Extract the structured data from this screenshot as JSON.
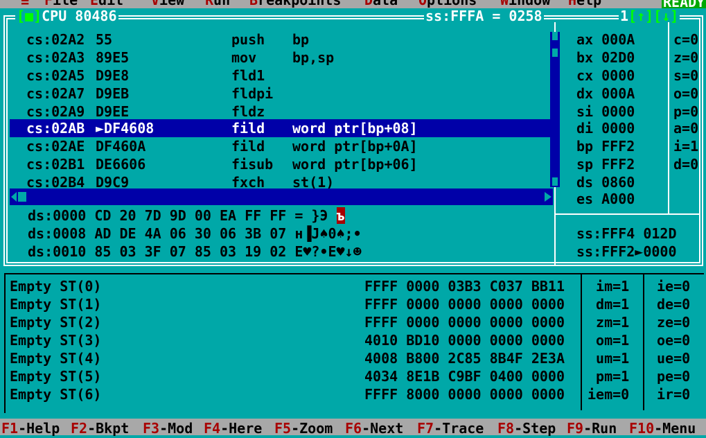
{
  "menu": {
    "system": "≡",
    "items": [
      {
        "hot": "F",
        "rest": "ile"
      },
      {
        "hot": "E",
        "rest": "dit"
      },
      {
        "hot": "V",
        "rest": "iew"
      },
      {
        "hot": "R",
        "rest": "un"
      },
      {
        "hot": "B",
        "rest": "reakpoints"
      },
      {
        "hot": "D",
        "rest": "ata"
      },
      {
        "hot": "O",
        "rest": "ptions"
      },
      {
        "hot": "W",
        "rest": "indow"
      },
      {
        "hot": "H",
        "rest": "elp"
      }
    ],
    "status": "READY"
  },
  "cpu": {
    "title": "CPU 80486",
    "close_box": "[■]",
    "stack_top": "ss:FFFA = 0258",
    "window_number": "1",
    "up_arrow": "[↑]",
    "down_arrow": "[↓]"
  },
  "disasm": [
    {
      "addr": "cs:02A2",
      "bytes": "55",
      "op": "push",
      "args": "bp"
    },
    {
      "addr": "cs:02A3",
      "bytes": "89E5",
      "op": "mov",
      "args": "bp,sp"
    },
    {
      "addr": "cs:02A5",
      "bytes": "D9E8",
      "op": "fld1",
      "args": ""
    },
    {
      "addr": "cs:02A7",
      "bytes": "D9EB",
      "op": "fldpi",
      "args": ""
    },
    {
      "addr": "cs:02A9",
      "bytes": "D9EE",
      "op": "fldz",
      "args": ""
    },
    {
      "addr": "cs:02AB",
      "bytes": "►DF4608",
      "op": "fild",
      "args": "word ptr[bp+08]"
    },
    {
      "addr": "cs:02AE",
      "bytes": "DF460A",
      "op": "fild",
      "args": "word ptr[bp+0A]"
    },
    {
      "addr": "cs:02B1",
      "bytes": "DE6606",
      "op": "fisub",
      "args": "word ptr[bp+06]"
    },
    {
      "addr": "cs:02B4",
      "bytes": "D9C9",
      "op": "fxch",
      "args": "st(1)"
    }
  ],
  "registers": [
    {
      "name": "ax",
      "value": "000A"
    },
    {
      "name": "bx",
      "value": "02D0"
    },
    {
      "name": "cx",
      "value": "0000"
    },
    {
      "name": "dx",
      "value": "000A"
    },
    {
      "name": "si",
      "value": "0000"
    },
    {
      "name": "di",
      "value": "0000"
    },
    {
      "name": "bp",
      "value": "FFF2"
    },
    {
      "name": "sp",
      "value": "FFF2"
    },
    {
      "name": "ds",
      "value": "0860"
    },
    {
      "name": "es",
      "value": "A000"
    }
  ],
  "flags": [
    "c=0",
    "z=0",
    "s=0",
    "o=0",
    "p=0",
    "a=0",
    "i=1",
    "d=0"
  ],
  "dump": [
    {
      "text": "ds:0000 CD 20 7D 9D 00 EA FF FF = }Э ",
      "tail": "ъ"
    },
    {
      "text": "ds:0008 AD DE 4A 06 30 06 3B 07 н▐J♠0♠;•",
      "tail": ""
    },
    {
      "text": "ds:0010 85 03 3F 07 85 03 19 02 Е♥?•Е♥↓☻",
      "tail": ""
    }
  ],
  "stack": [
    "ss:FFF4 012D",
    "ss:FFF2►0000"
  ],
  "fpu": {
    "registers": [
      {
        "label": "Empty ST(0)",
        "hex": "FFFF 0000 03B3 C037 BB11"
      },
      {
        "label": "Empty ST(1)",
        "hex": "FFFF 0000 0000 0000 0000"
      },
      {
        "label": "Empty ST(2)",
        "hex": "FFFF 0000 0000 0000 0000"
      },
      {
        "label": "Empty ST(3)",
        "hex": "4010 BD10 0000 0000 0000"
      },
      {
        "label": "Empty ST(4)",
        "hex": "4008 B800 2C85 8B4F 2E3A"
      },
      {
        "label": "Empty ST(5)",
        "hex": "4034 8E1B C9BF 0400 0000"
      },
      {
        "label": "Empty ST(6)",
        "hex": "FFFF 8000 0000 0000 0000"
      }
    ],
    "control": [
      " im=1",
      " dm=1",
      " zm=1",
      " om=1",
      " um=1",
      " pm=1",
      "iem=0"
    ],
    "status": [
      "ie=0",
      "de=0",
      "ze=0",
      "oe=0",
      "ue=0",
      "pe=0",
      "ir=0"
    ]
  },
  "function_keys": [
    {
      "key": "F1",
      "label": "-Help"
    },
    {
      "key": "F2",
      "label": "-Bkpt"
    },
    {
      "key": "F3",
      "label": "-Mod"
    },
    {
      "key": "F4",
      "label": "-Here"
    },
    {
      "key": "F5",
      "label": "-Zoom"
    },
    {
      "key": "F6",
      "label": "-Next"
    },
    {
      "key": "F7",
      "label": "-Trace"
    },
    {
      "key": "F8",
      "label": "-Step"
    },
    {
      "key": "F9",
      "label": "-Run"
    },
    {
      "key": "F10",
      "label": "-Menu"
    }
  ],
  "colors": {
    "background": "#00a8a8",
    "selection": "#0000a8",
    "hotkey": "#a80000",
    "bar": "#a8a8a8",
    "ready": "#00a800"
  }
}
